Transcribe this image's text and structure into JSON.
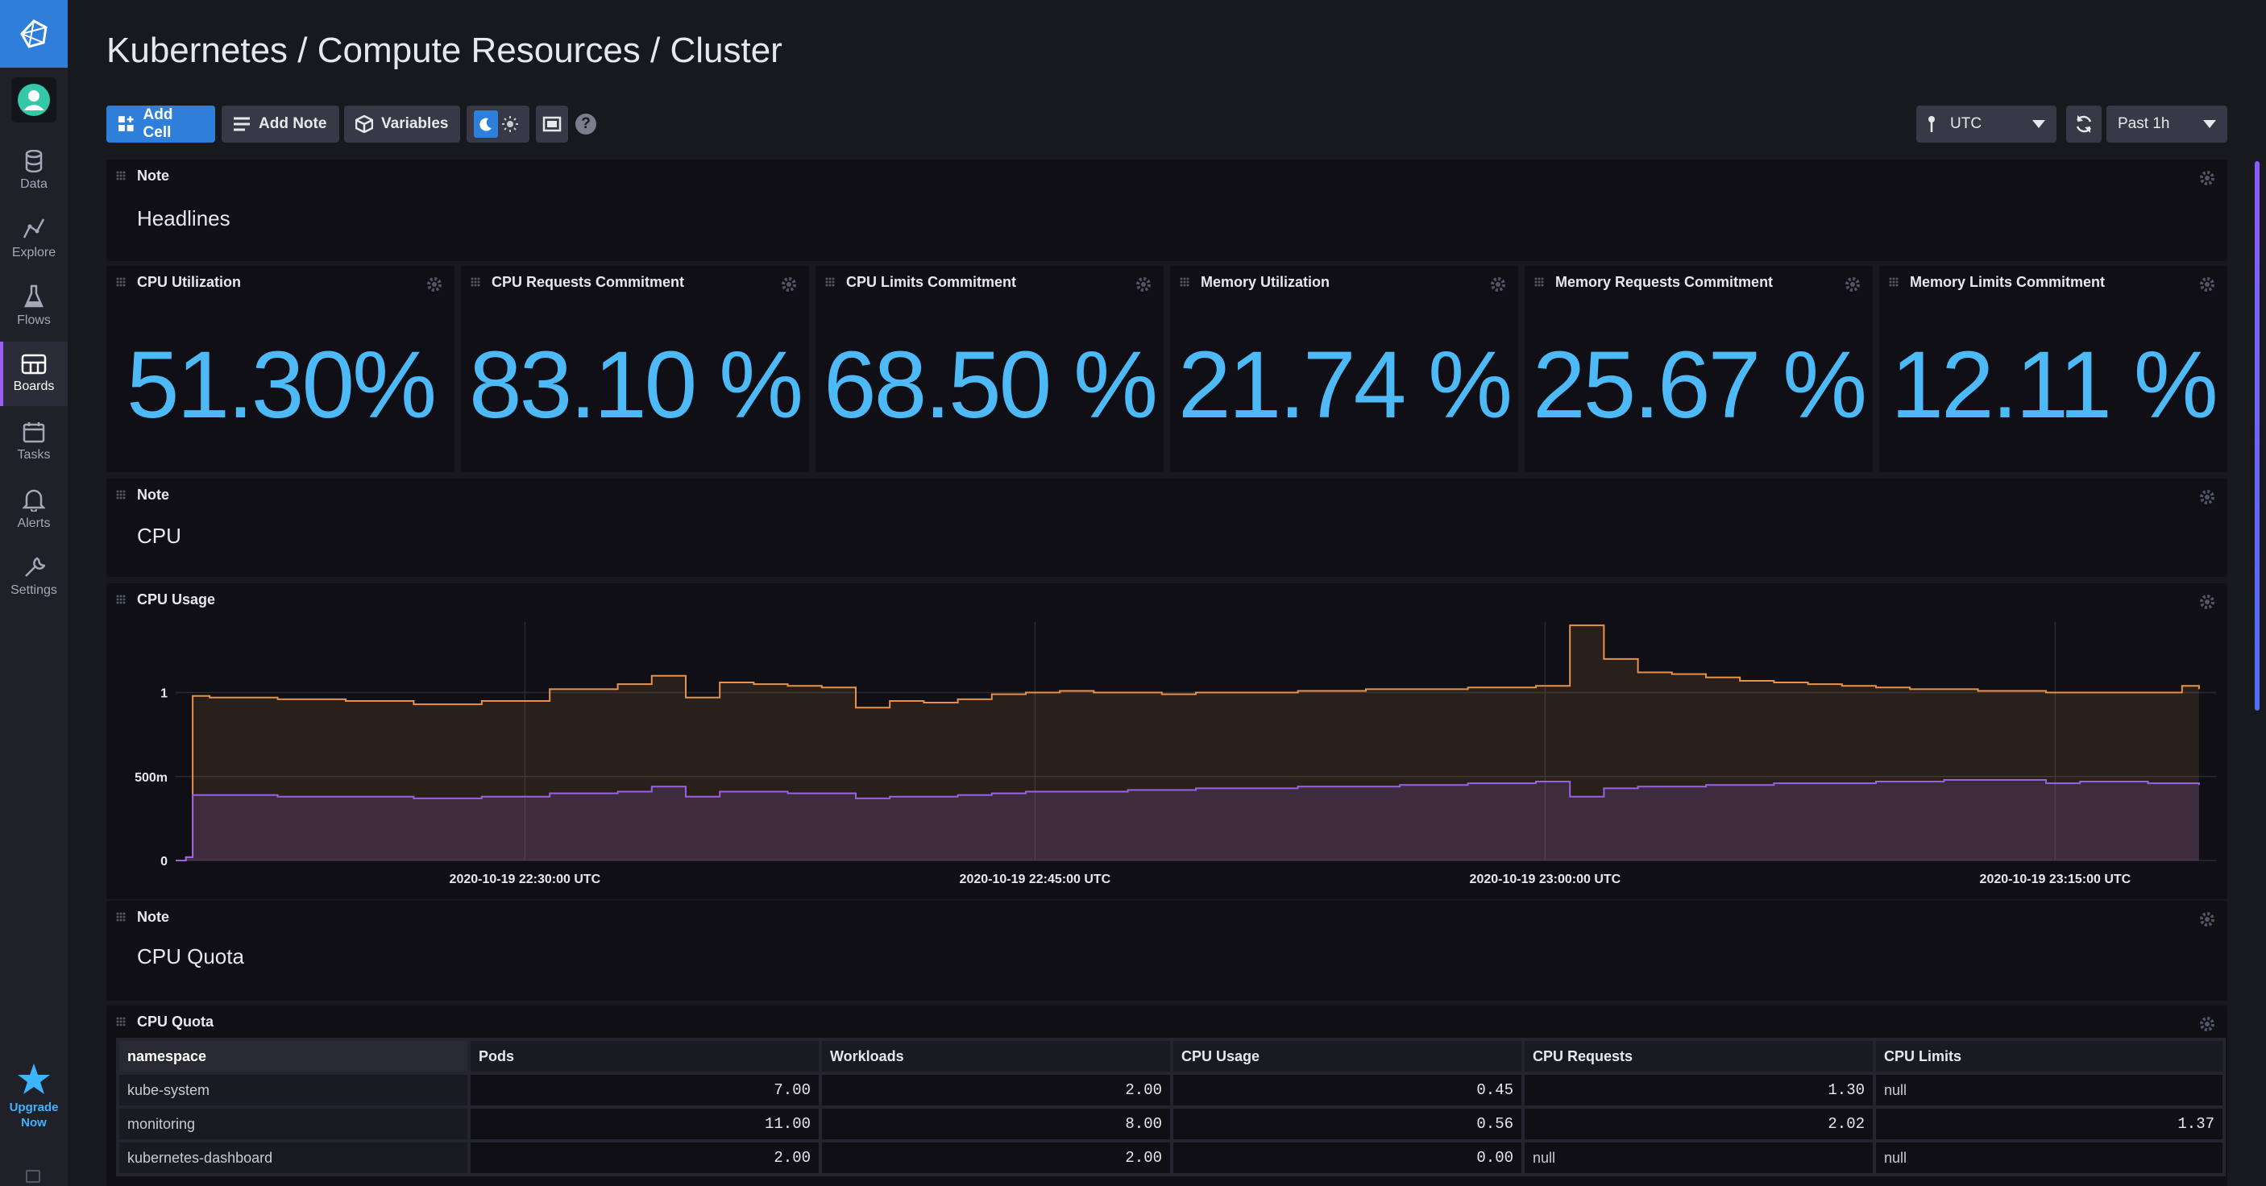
{
  "nav": {
    "items": [
      {
        "label": "Data",
        "icon": "database-icon"
      },
      {
        "label": "Explore",
        "icon": "graph-icon"
      },
      {
        "label": "Flows",
        "icon": "flask-icon"
      },
      {
        "label": "Boards",
        "icon": "dashboard-icon"
      },
      {
        "label": "Tasks",
        "icon": "calendar-icon"
      },
      {
        "label": "Alerts",
        "icon": "bell-icon"
      },
      {
        "label": "Settings",
        "icon": "wrench-icon"
      }
    ],
    "active": "Boards",
    "upgrade_line1": "Upgrade",
    "upgrade_line2": "Now"
  },
  "header": {
    "title": "Kubernetes / Compute Resources / Cluster"
  },
  "toolbar": {
    "add_cell": "Add Cell",
    "add_note": "Add Note",
    "variables": "Variables",
    "timezone": "UTC",
    "time_range": "Past 1h"
  },
  "cells": {
    "note_headlines": {
      "title": "Note",
      "body": "Headlines"
    },
    "stats": [
      {
        "title": "CPU Utilization",
        "value": "51.30%"
      },
      {
        "title": "CPU Requests Commitment",
        "value": "83.10 %"
      },
      {
        "title": "CPU Limits Commitment",
        "value": "68.50 %"
      },
      {
        "title": "Memory Utilization",
        "value": "21.74 %"
      },
      {
        "title": "Memory Requests Commitment",
        "value": "25.67 %"
      },
      {
        "title": "Memory Limits Commitment",
        "value": "12.11 %"
      }
    ],
    "note_cpu": {
      "title": "Note",
      "body": "CPU"
    },
    "cpu_usage": {
      "title": "CPU Usage"
    },
    "note_cpu_quota": {
      "title": "Note",
      "body": "CPU Quota"
    },
    "cpu_quota": {
      "title": "CPU Quota"
    }
  },
  "chart_data": {
    "type": "area",
    "x_tick_labels": [
      "2020-10-19 22:30:00 UTC",
      "2020-10-19 22:45:00 UTC",
      "2020-10-19 23:00:00 UTC",
      "2020-10-19 23:15:00 UTC"
    ],
    "y_tick_labels": [
      "0",
      "500m",
      "1"
    ],
    "y_ticks": [
      0,
      0.5,
      1
    ],
    "ylim": [
      0,
      1.42
    ],
    "xlim": [
      0,
      60
    ],
    "grid": true,
    "colors": {
      "series1": "#e8914a",
      "series2": "#9b62e0"
    },
    "series": [
      {
        "x": [
          0,
          0.3,
          0.5,
          1,
          3,
          5,
          7,
          9,
          11,
          13,
          14,
          15,
          16,
          17,
          18,
          19,
          20,
          21,
          22,
          23,
          24,
          25,
          26,
          27,
          28,
          29,
          30,
          31,
          32,
          33,
          34,
          35,
          36,
          37,
          38,
          39,
          40,
          41,
          42,
          43,
          44,
          45,
          46,
          47,
          48,
          49,
          50,
          51,
          52,
          53,
          54,
          55,
          56,
          57,
          58,
          59,
          59.5
        ],
        "values": [
          0,
          0.02,
          0.98,
          0.97,
          0.96,
          0.95,
          0.93,
          0.95,
          1.02,
          1.05,
          1.1,
          0.97,
          1.06,
          1.05,
          1.04,
          1.03,
          0.91,
          0.95,
          0.94,
          0.96,
          0.99,
          1.0,
          1.01,
          1.0,
          1.0,
          0.99,
          1.0,
          1.0,
          1.0,
          1.01,
          1.01,
          1.02,
          1.02,
          1.02,
          1.03,
          1.03,
          1.04,
          1.4,
          1.2,
          1.12,
          1.11,
          1.09,
          1.07,
          1.06,
          1.05,
          1.04,
          1.03,
          1.02,
          1.02,
          1.01,
          1.01,
          1.0,
          1.0,
          1.0,
          1.0,
          1.04,
          1.02
        ]
      },
      {
        "x": [
          0,
          0.3,
          0.5,
          1,
          3,
          5,
          7,
          9,
          11,
          13,
          14,
          15,
          16,
          17,
          18,
          19,
          20,
          21,
          22,
          23,
          24,
          25,
          26,
          27,
          28,
          29,
          30,
          31,
          32,
          33,
          34,
          35,
          36,
          37,
          38,
          39,
          40,
          41,
          42,
          43,
          44,
          45,
          46,
          47,
          48,
          49,
          50,
          51,
          52,
          53,
          54,
          55,
          56,
          57,
          58,
          59,
          59.5
        ],
        "values": [
          0,
          0.02,
          0.39,
          0.39,
          0.38,
          0.38,
          0.37,
          0.38,
          0.4,
          0.41,
          0.44,
          0.38,
          0.41,
          0.41,
          0.4,
          0.4,
          0.37,
          0.38,
          0.38,
          0.39,
          0.4,
          0.41,
          0.41,
          0.41,
          0.42,
          0.42,
          0.43,
          0.43,
          0.43,
          0.44,
          0.44,
          0.44,
          0.45,
          0.45,
          0.46,
          0.46,
          0.47,
          0.38,
          0.43,
          0.44,
          0.44,
          0.45,
          0.45,
          0.46,
          0.46,
          0.46,
          0.47,
          0.47,
          0.48,
          0.48,
          0.48,
          0.46,
          0.47,
          0.47,
          0.46,
          0.46,
          0.45
        ]
      }
    ]
  },
  "table": {
    "columns": [
      "namespace",
      "Pods",
      "Workloads",
      "CPU Usage",
      "CPU Requests",
      "CPU Limits"
    ],
    "rows": [
      [
        "kube-system",
        "7.00",
        "2.00",
        "0.45",
        "1.30",
        "null"
      ],
      [
        "monitoring",
        "11.00",
        "8.00",
        "0.56",
        "2.02",
        "1.37"
      ],
      [
        "kubernetes-dashboard",
        "2.00",
        "2.00",
        "0.00",
        "null",
        "null"
      ]
    ]
  }
}
